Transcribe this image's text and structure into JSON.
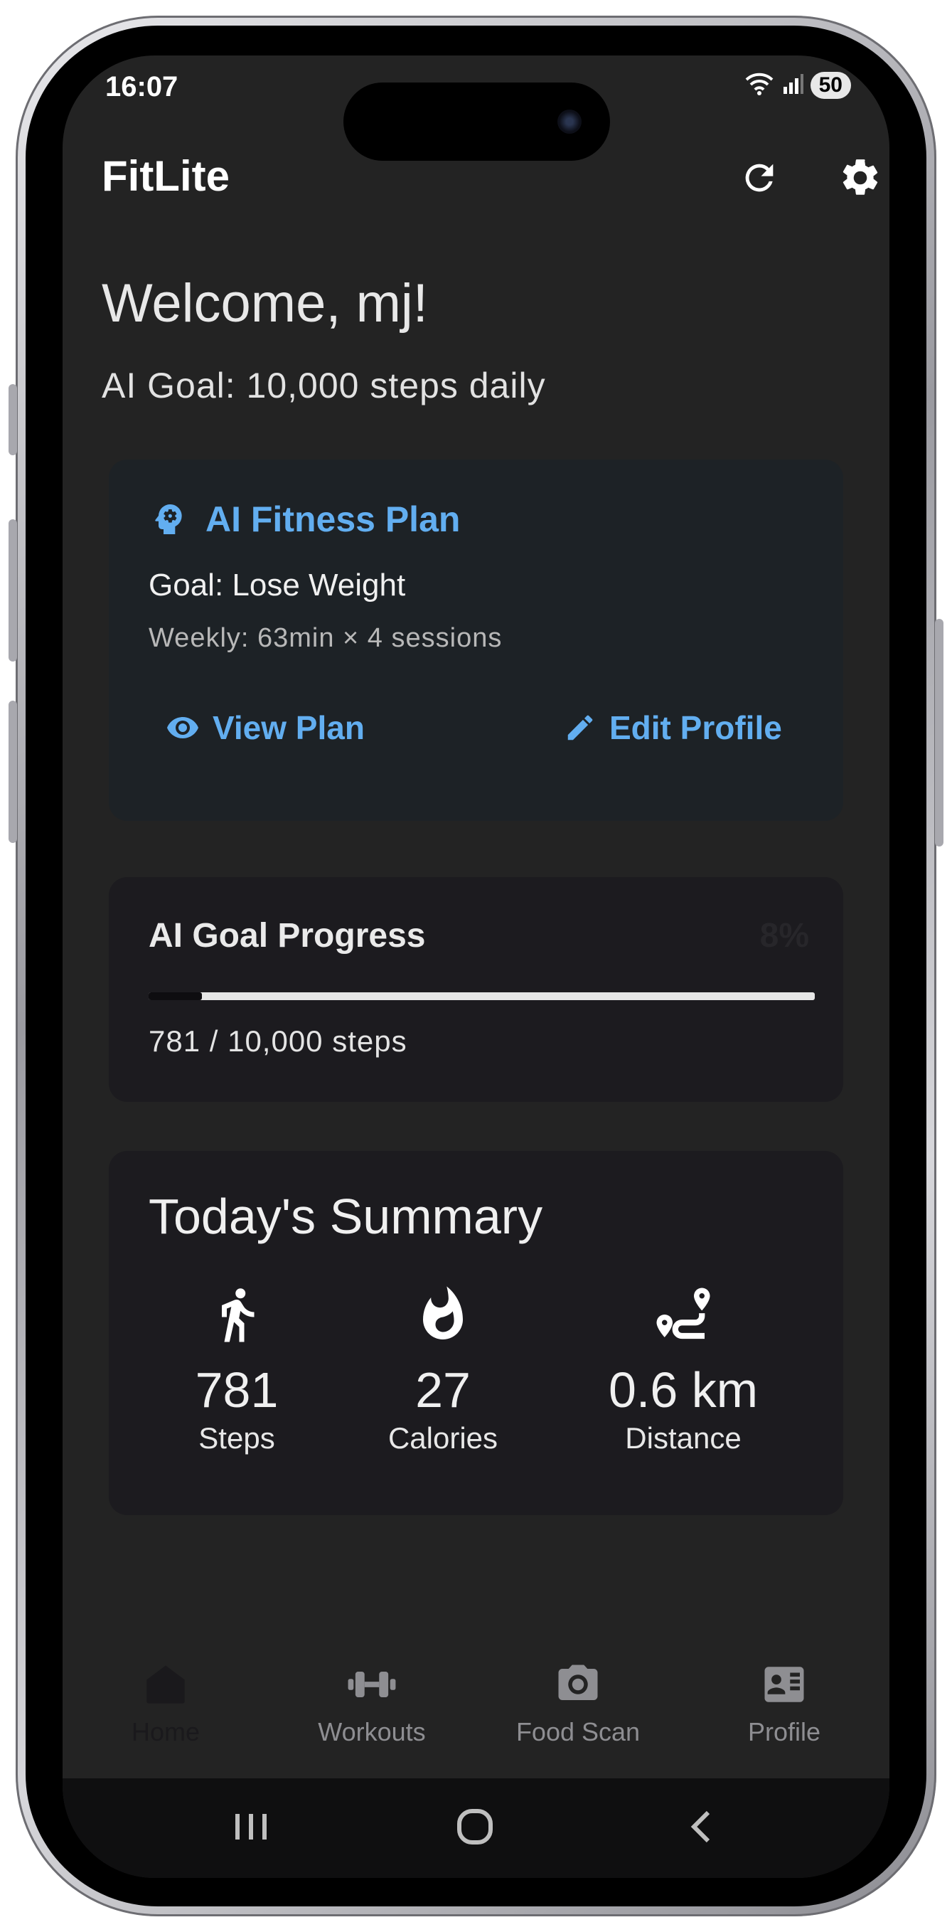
{
  "status_bar": {
    "time": "16:07",
    "battery": "50"
  },
  "app_bar": {
    "title": "FitLite",
    "refresh_icon": "refresh-icon",
    "settings_icon": "gear-icon"
  },
  "welcome": {
    "greeting": "Welcome, mj!",
    "goal_line": "AI Goal: 10,000 steps daily"
  },
  "plan_card": {
    "title": "AI Fitness Plan",
    "goal": "Goal: Lose Weight",
    "weekly": "Weekly: 63min × 4 sessions",
    "view_label": "View Plan",
    "edit_label": "Edit Profile"
  },
  "progress_card": {
    "title": "AI Goal Progress",
    "percent": "8%",
    "progress_value": 0.08,
    "steps_text": "781 / 10,000 steps"
  },
  "summary_card": {
    "title": "Today's Summary",
    "stats": [
      {
        "value": "781",
        "label": "Steps",
        "icon": "walking-icon"
      },
      {
        "value": "27",
        "label": "Calories",
        "icon": "flame-icon"
      },
      {
        "value": "0.6 km",
        "label": "Distance",
        "icon": "route-icon"
      }
    ]
  },
  "bottom_nav": {
    "items": [
      {
        "label": "Home",
        "icon": "home-icon",
        "active": true
      },
      {
        "label": "Workouts",
        "icon": "dumbbell-icon",
        "active": false
      },
      {
        "label": "Food Scan",
        "icon": "camera-icon",
        "active": false
      },
      {
        "label": "Profile",
        "icon": "id-card-icon",
        "active": false
      }
    ]
  },
  "colors": {
    "accent": "#62aef0",
    "background": "#232323",
    "card": "#1c1b1f"
  }
}
